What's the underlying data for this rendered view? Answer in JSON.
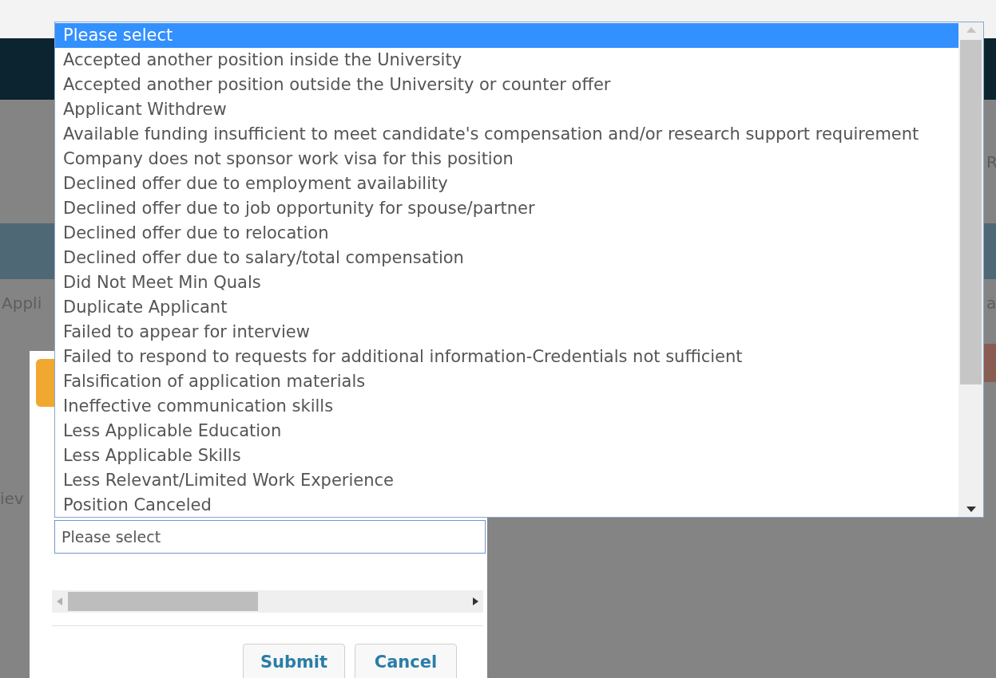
{
  "background": {
    "fragments_top_right": "R",
    "fragment_left": "Appli",
    "fragment_right": "a",
    "fragment_bottom_left": "iev"
  },
  "dialog": {
    "select": {
      "value": "Please select",
      "expanded": true
    },
    "buttons": [
      {
        "label": "Submit"
      },
      {
        "label": "Cancel"
      }
    ]
  },
  "dropdown": {
    "options": [
      {
        "label": "Please select",
        "selected": true
      },
      {
        "label": "Accepted another position inside the University",
        "selected": false
      },
      {
        "label": "Accepted another position outside the University or counter offer",
        "selected": false
      },
      {
        "label": "Applicant Withdrew",
        "selected": false
      },
      {
        "label": "Available funding insufficient to meet candidate's compensation and/or research support requirement",
        "selected": false
      },
      {
        "label": "Company does not sponsor work visa for this position",
        "selected": false
      },
      {
        "label": "Declined offer due to employment availability",
        "selected": false
      },
      {
        "label": "Declined offer due to job opportunity for spouse/partner",
        "selected": false
      },
      {
        "label": "Declined offer due to relocation",
        "selected": false
      },
      {
        "label": "Declined offer due to salary/total compensation",
        "selected": false
      },
      {
        "label": "Did Not Meet Min Quals",
        "selected": false
      },
      {
        "label": "Duplicate Applicant",
        "selected": false
      },
      {
        "label": "Failed to appear for interview",
        "selected": false
      },
      {
        "label": "Failed to respond to requests for additional information-Credentials not sufficient",
        "selected": false
      },
      {
        "label": "Falsification of application materials",
        "selected": false
      },
      {
        "label": "Ineffective communication skills",
        "selected": false
      },
      {
        "label": "Less Applicable Education",
        "selected": false
      },
      {
        "label": "Less Applicable Skills",
        "selected": false
      },
      {
        "label": "Less Relevant/Limited Work Experience",
        "selected": false
      },
      {
        "label": "Position Canceled",
        "selected": false
      }
    ]
  }
}
